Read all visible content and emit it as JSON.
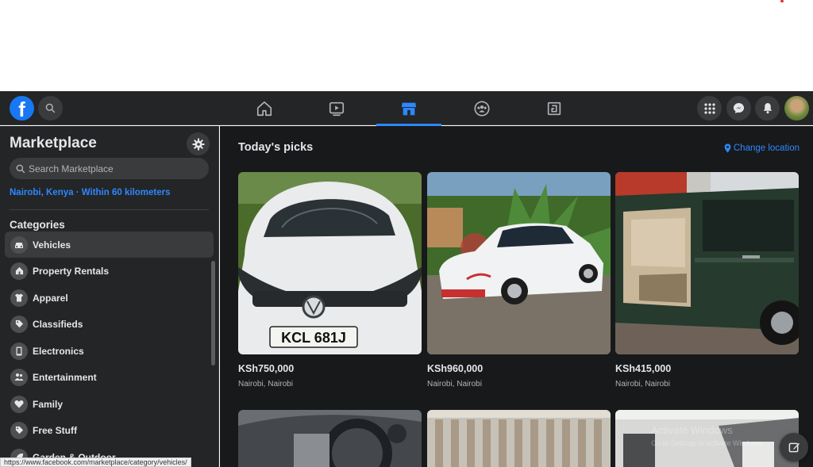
{
  "header": {
    "logo_letter": "f",
    "nav_tabs": [
      {
        "name": "home",
        "icon": "home-icon"
      },
      {
        "name": "watch",
        "icon": "video-icon"
      },
      {
        "name": "marketplace",
        "icon": "store-icon",
        "active": true
      },
      {
        "name": "groups",
        "icon": "groups-icon"
      },
      {
        "name": "gaming",
        "icon": "gaming-icon"
      }
    ],
    "right_icons": [
      "grid-menu-icon",
      "messenger-icon",
      "bell-icon",
      "avatar"
    ]
  },
  "sidebar": {
    "title": "Marketplace",
    "search_placeholder": "Search Marketplace",
    "location": "Nairobi, Kenya · Within 60 kilometers",
    "categories_heading": "Categories",
    "categories": [
      {
        "label": "Vehicles",
        "icon": "car-icon",
        "active": true
      },
      {
        "label": "Property Rentals",
        "icon": "house-icon"
      },
      {
        "label": "Apparel",
        "icon": "shirt-icon"
      },
      {
        "label": "Classifieds",
        "icon": "tag-icon"
      },
      {
        "label": "Electronics",
        "icon": "phone-icon"
      },
      {
        "label": "Entertainment",
        "icon": "people-icon"
      },
      {
        "label": "Family",
        "icon": "heart-icon"
      },
      {
        "label": "Free Stuff",
        "icon": "tag-icon"
      },
      {
        "label": "Garden & Outdoor",
        "icon": "leaf-icon"
      }
    ]
  },
  "main": {
    "title": "Today's picks",
    "change_location": "Change location",
    "listings": [
      {
        "price": "KSh750,000",
        "location": "Nairobi, Nairobi",
        "plate": "KCL 681J"
      },
      {
        "price": "KSh960,000",
        "location": "Nairobi, Nairobi"
      },
      {
        "price": "KSh415,000",
        "location": "Nairobi, Nairobi"
      }
    ]
  },
  "status_bar_url": "https://www.facebook.com/marketplace/category/vehicles/",
  "watermark": {
    "line1": "Activate Windows",
    "line2": "Go to Settings to activate Windows."
  },
  "colors": {
    "accent": "#2d88ff",
    "surface": "#242526",
    "background": "#18191a",
    "text": "#e4e6eb"
  }
}
